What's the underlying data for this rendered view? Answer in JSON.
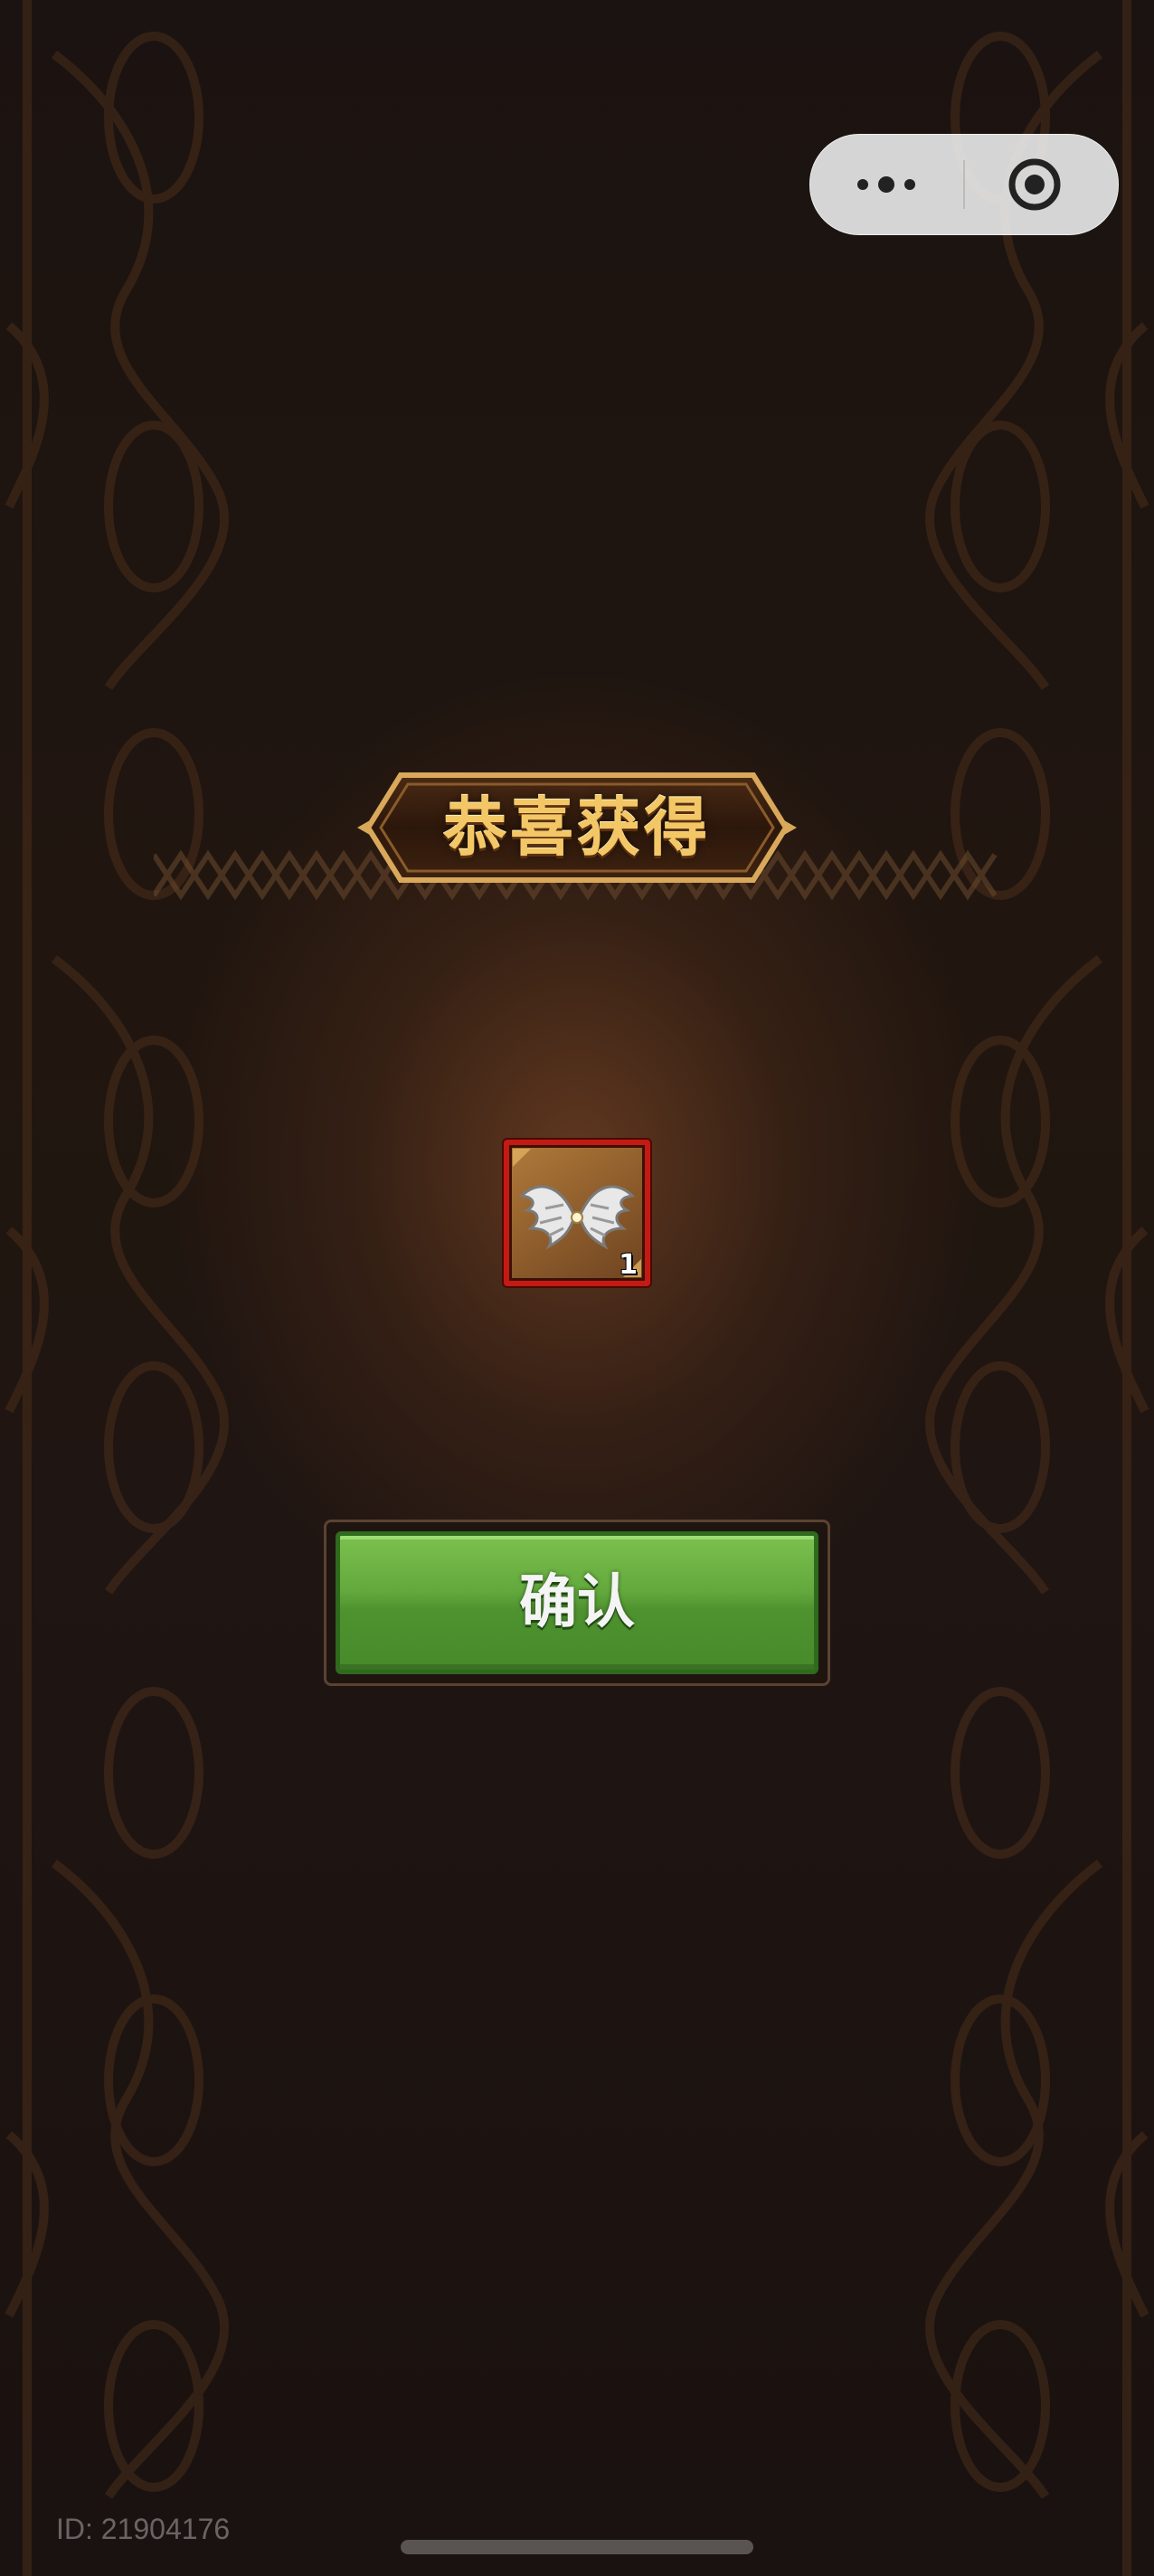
{
  "capsule": {
    "more_icon": "more-dots-icon",
    "close_icon": "target-circle-icon"
  },
  "banner": {
    "title": "恭喜获得"
  },
  "reward": {
    "item_icon": "silver-wings-icon",
    "count": "1",
    "frame_color": "#c41a14"
  },
  "confirm": {
    "label": "确认",
    "color": "#62a83c"
  },
  "footer": {
    "id_text": "ID: 21904176"
  },
  "theme": {
    "background": "#1a1210",
    "gold": "#f3c766"
  }
}
